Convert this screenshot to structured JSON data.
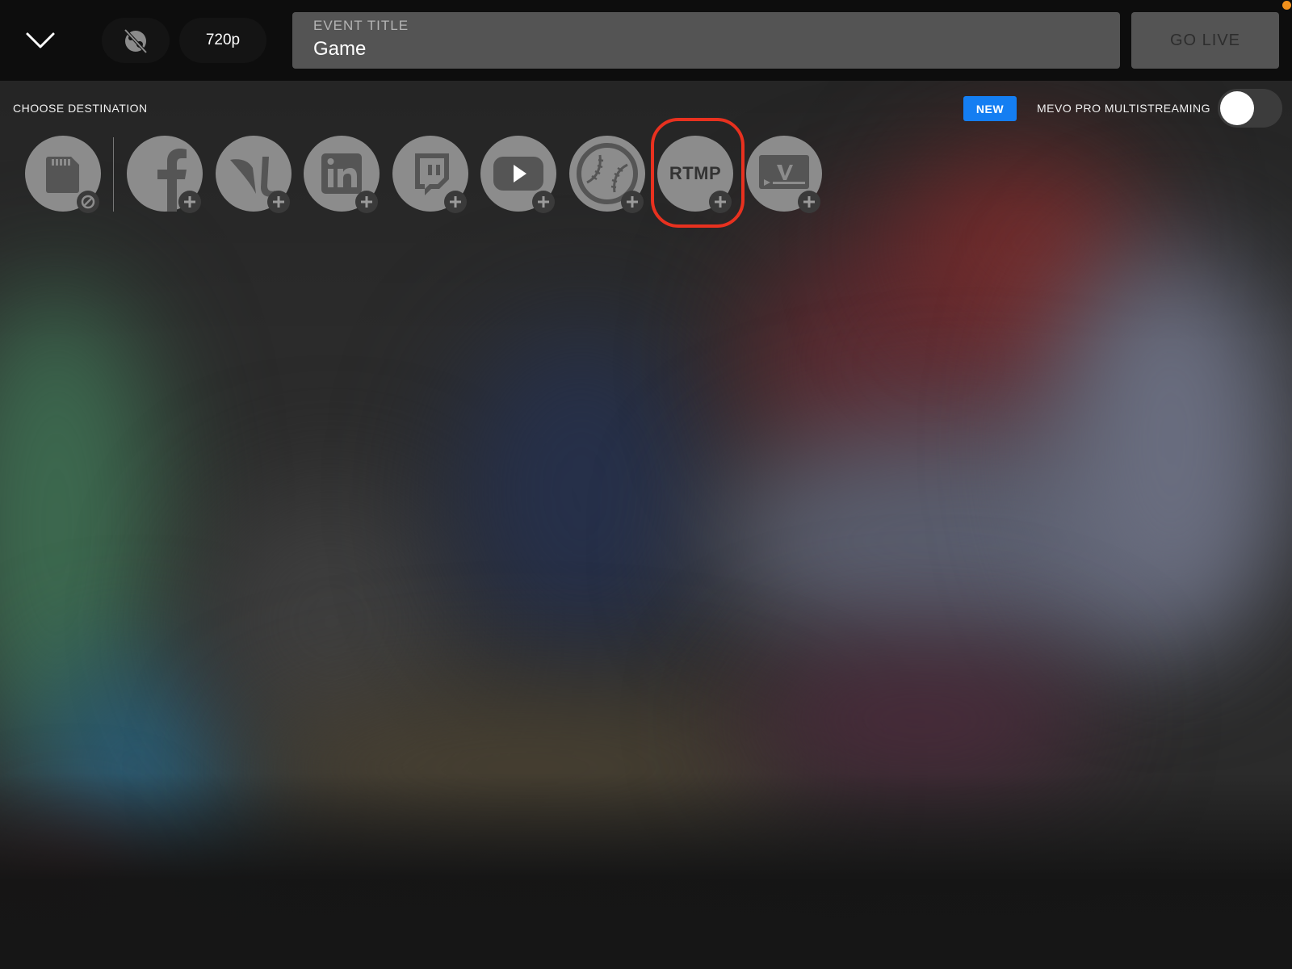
{
  "topbar": {
    "resolution": "720p",
    "event_title_label": "EVENT TITLE",
    "event_title_value": "Game",
    "go_live_label": "GO LIVE"
  },
  "destinations_bar": {
    "choose_label": "CHOOSE DESTINATION",
    "new_badge": "NEW",
    "multistream_label": "MEVO PRO MULTISTREAMING",
    "multistream_enabled": false
  },
  "destinations": [
    {
      "name": "sd-card",
      "icon": "sd-card-icon",
      "badge": "disabled"
    },
    {
      "name": "facebook",
      "icon": "facebook-icon",
      "badge": "add"
    },
    {
      "name": "livestream",
      "icon": "livestream-icon",
      "badge": "add"
    },
    {
      "name": "linkedin",
      "icon": "linkedin-icon",
      "badge": "add"
    },
    {
      "name": "twitch",
      "icon": "twitch-icon",
      "badge": "add"
    },
    {
      "name": "youtube",
      "icon": "youtube-icon",
      "badge": "add"
    },
    {
      "name": "baseball",
      "icon": "baseball-icon",
      "badge": "add"
    },
    {
      "name": "rtmp",
      "label": "RTMP",
      "badge": "add",
      "highlighted": true
    },
    {
      "name": "vimeo",
      "icon": "vimeo-icon",
      "badge": "add"
    }
  ],
  "colors": {
    "accent_blue": "#147ef2",
    "highlight_red": "#e8311f",
    "recording_dot": "#f0901c"
  }
}
